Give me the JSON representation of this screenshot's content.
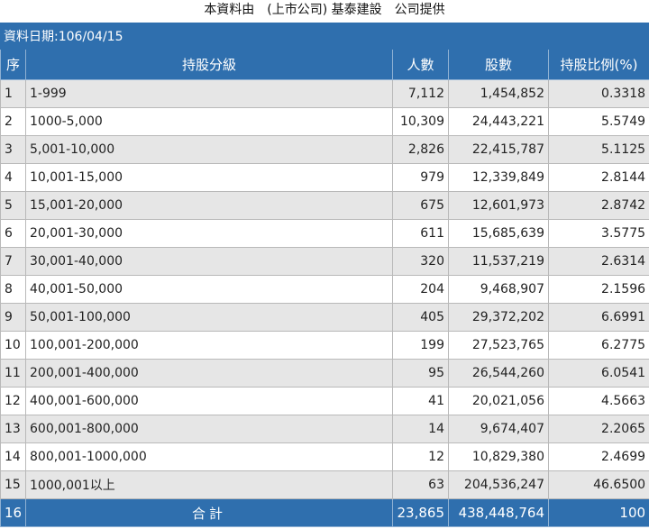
{
  "caption": "本資料由　(上市公司) 基泰建設　公司提供",
  "date_label": "資料日期:106/04/15",
  "headers": {
    "seq": "序",
    "level": "持股分級",
    "people": "人數",
    "shares": "股數",
    "ratio": "持股比例(%)"
  },
  "rows": [
    {
      "seq": "1",
      "level": "1-999",
      "people": "7,112",
      "shares": "1,454,852",
      "ratio": "0.3318"
    },
    {
      "seq": "2",
      "level": "1000-5,000",
      "people": "10,309",
      "shares": "24,443,221",
      "ratio": "5.5749"
    },
    {
      "seq": "3",
      "level": "5,001-10,000",
      "people": "2,826",
      "shares": "22,415,787",
      "ratio": "5.1125"
    },
    {
      "seq": "4",
      "level": "10,001-15,000",
      "people": "979",
      "shares": "12,339,849",
      "ratio": "2.8144"
    },
    {
      "seq": "5",
      "level": "15,001-20,000",
      "people": "675",
      "shares": "12,601,973",
      "ratio": "2.8742"
    },
    {
      "seq": "6",
      "level": "20,001-30,000",
      "people": "611",
      "shares": "15,685,639",
      "ratio": "3.5775"
    },
    {
      "seq": "7",
      "level": "30,001-40,000",
      "people": "320",
      "shares": "11,537,219",
      "ratio": "2.6314"
    },
    {
      "seq": "8",
      "level": "40,001-50,000",
      "people": "204",
      "shares": "9,468,907",
      "ratio": "2.1596"
    },
    {
      "seq": "9",
      "level": "50,001-100,000",
      "people": "405",
      "shares": "29,372,202",
      "ratio": "6.6991"
    },
    {
      "seq": "10",
      "level": "100,001-200,000",
      "people": "199",
      "shares": "27,523,765",
      "ratio": "6.2775"
    },
    {
      "seq": "11",
      "level": "200,001-400,000",
      "people": "95",
      "shares": "26,544,260",
      "ratio": "6.0541"
    },
    {
      "seq": "12",
      "level": "400,001-600,000",
      "people": "41",
      "shares": "20,021,056",
      "ratio": "4.5663"
    },
    {
      "seq": "13",
      "level": "600,001-800,000",
      "people": "14",
      "shares": "9,674,407",
      "ratio": "2.2065"
    },
    {
      "seq": "14",
      "level": "800,001-1000,000",
      "people": "12",
      "shares": "10,829,380",
      "ratio": "2.4699"
    },
    {
      "seq": "15",
      "level": "1000,001以上",
      "people": "63",
      "shares": "204,536,247",
      "ratio": "46.6500"
    }
  ],
  "total": {
    "seq": "16",
    "label": "合計",
    "people": "23,865",
    "shares": "438,448,764",
    "ratio": "100"
  },
  "colors": {
    "header_bg": "#2f6fae",
    "row_alt": "#e6e6e6",
    "border": "#b9b9b9"
  }
}
